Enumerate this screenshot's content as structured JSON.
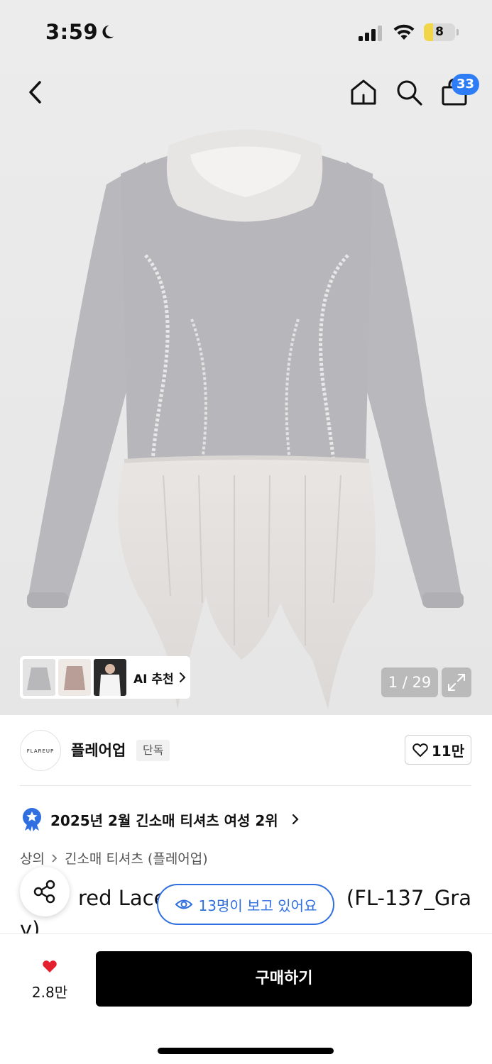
{
  "status_bar": {
    "time": "3:59",
    "battery_level": "8",
    "battery_color": "#f1d64a"
  },
  "nav": {
    "back_icon": "chevron-left-icon",
    "home_icon": "home-icon",
    "search_icon": "search-icon",
    "cart_icon": "shopping-bag-icon",
    "cart_badge": "33",
    "badge_color": "#2f7df6"
  },
  "gallery": {
    "ai_recommend_label": "AI 추천",
    "counter": "1 / 29",
    "expand_icon": "expand-icon"
  },
  "brand": {
    "logo_text": "FLAREUP",
    "name": "플레어업",
    "tag": "단독",
    "like_count": "11만"
  },
  "ranking": {
    "text": "2025년 2월 긴소매 티셔츠 여성 2위"
  },
  "breadcrumb": {
    "items": [
      "상의",
      "긴소매 티셔츠 (플레어업)"
    ]
  },
  "product": {
    "title_visible_left": "red Lace",
    "title_visible_right": "(FL-137_Gra",
    "title_line2": "y)"
  },
  "viewers": {
    "text": "13명이 보고 있어요",
    "color": "#2f6fe0"
  },
  "bottom_bar": {
    "wish_count": "2.8만",
    "buy_label": "구매하기",
    "heart_color": "#e5202e"
  }
}
